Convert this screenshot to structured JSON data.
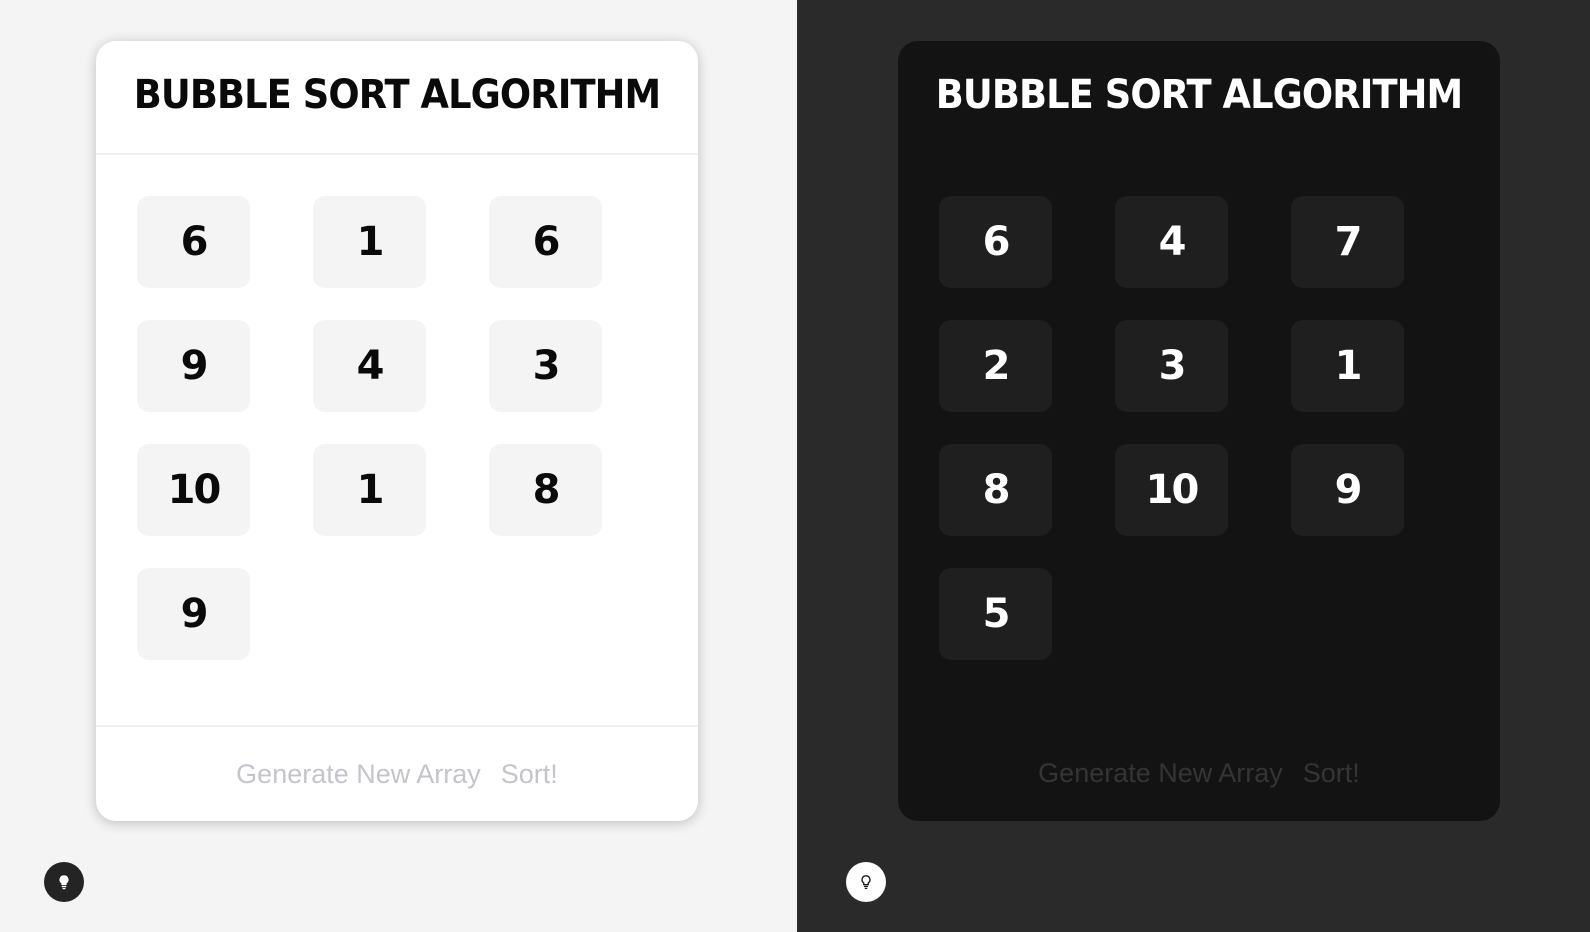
{
  "panels": [
    {
      "theme": "light",
      "title": "BUBBLE SORT ALGORITHM",
      "array": [
        "6",
        "1",
        "6",
        "9",
        "4",
        "3",
        "10",
        "1",
        "8",
        "9"
      ],
      "buttons": {
        "generate": "Generate New Array",
        "sort": "Sort!"
      },
      "toggle_icon": "lightbulb-icon"
    },
    {
      "theme": "dark",
      "title": "BUBBLE SORT ALGORITHM",
      "array": [
        "6",
        "4",
        "7",
        "2",
        "3",
        "1",
        "8",
        "10",
        "9",
        "5"
      ],
      "buttons": {
        "generate": "Generate New Array",
        "sort": "Sort!"
      },
      "toggle_icon": "lightbulb-icon"
    }
  ],
  "colors": {
    "light_background": "#f4f4f4",
    "dark_background": "#2a2a2a",
    "light_card": "#ffffff",
    "dark_card": "#131313",
    "light_cell": "#f4f4f4",
    "dark_cell": "#1f1f1f",
    "light_button_text": "#c6c3cb",
    "dark_button_text": "#353535"
  }
}
